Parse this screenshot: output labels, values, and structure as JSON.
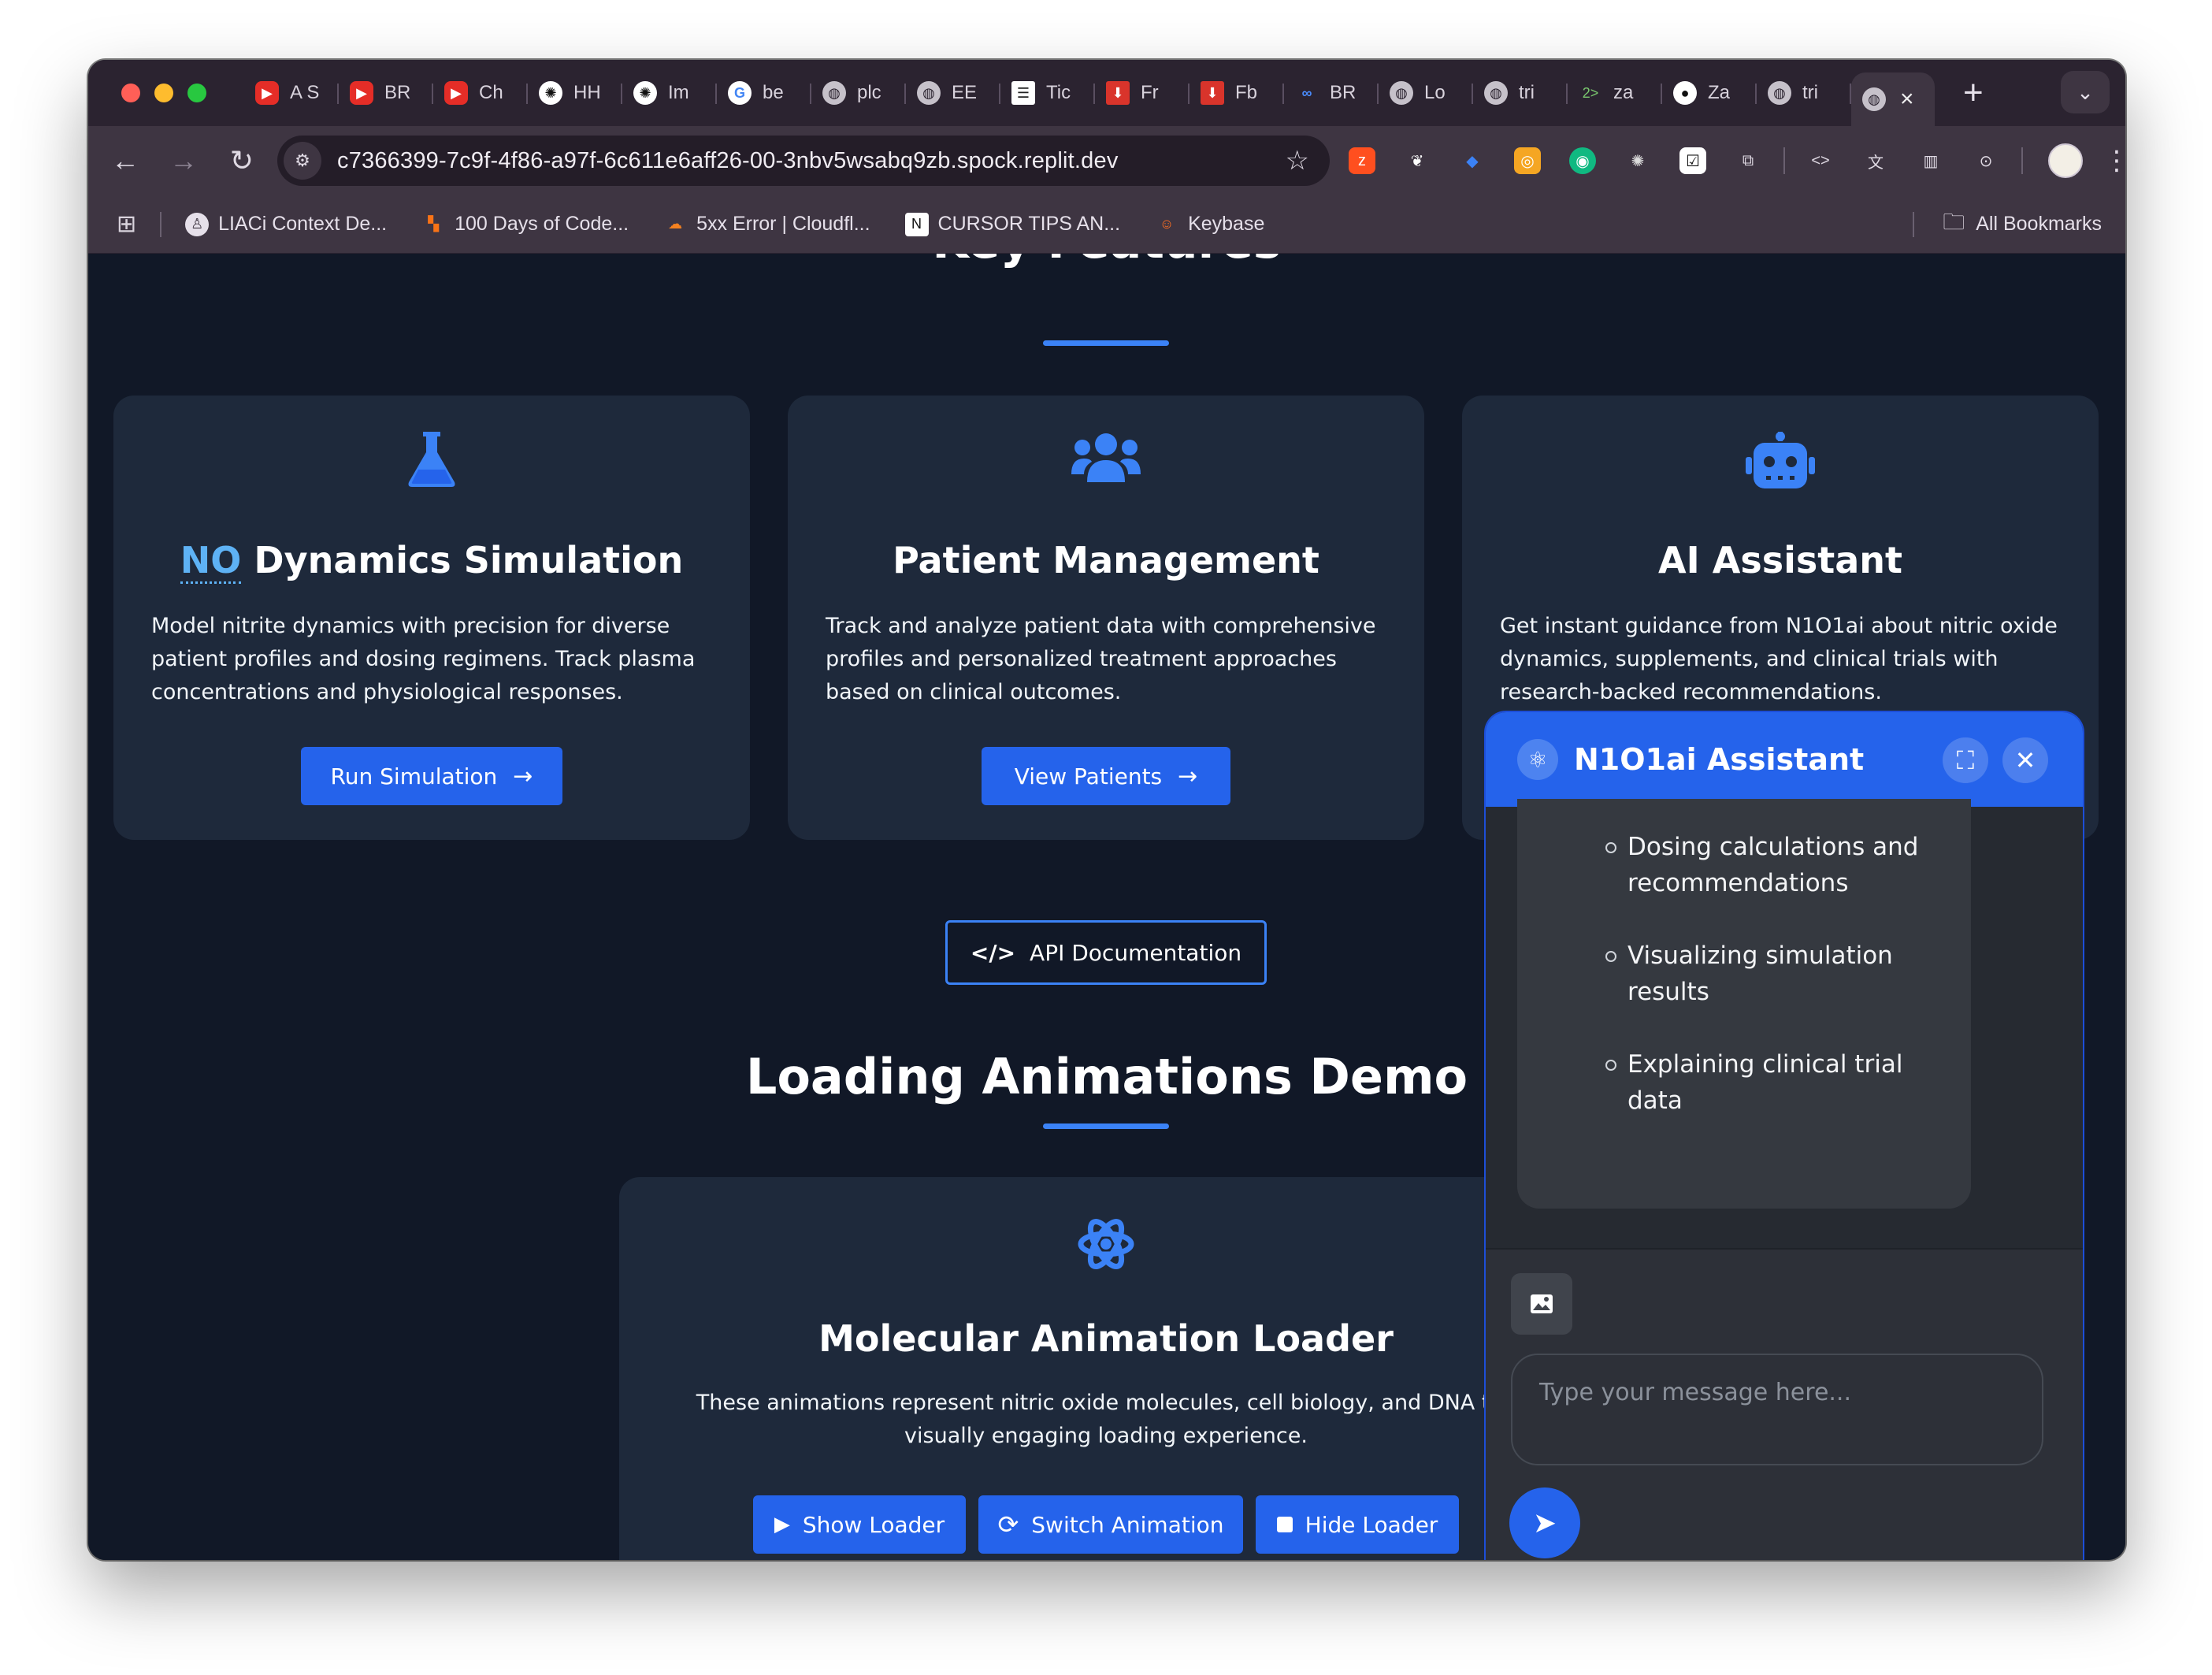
{
  "browser": {
    "tabs": [
      {
        "label": "A S",
        "icon": "youtube-icon"
      },
      {
        "label": "BR",
        "icon": "youtube-icon"
      },
      {
        "label": "Ch",
        "icon": "youtube-icon"
      },
      {
        "label": "HH",
        "icon": "openai-icon"
      },
      {
        "label": "Im",
        "icon": "openai-icon"
      },
      {
        "label": "be",
        "icon": "google-icon"
      },
      {
        "label": "plc",
        "icon": "globe-icon"
      },
      {
        "label": "EE",
        "icon": "globe-icon"
      },
      {
        "label": "Tic",
        "icon": "document-icon"
      },
      {
        "label": "Fr",
        "icon": "download-icon"
      },
      {
        "label": "Fb",
        "icon": "download-icon"
      },
      {
        "label": "BR",
        "icon": "link-icon"
      },
      {
        "label": "Lo",
        "icon": "globe-icon"
      },
      {
        "label": "tri",
        "icon": "globe-icon"
      },
      {
        "label": "za",
        "icon": "code-icon"
      },
      {
        "label": "Za",
        "icon": "github-icon"
      },
      {
        "label": "tri",
        "icon": "globe-icon"
      }
    ],
    "active_tab_close": "×",
    "new_tab": "+",
    "url": "c7366399-7c9f-4f86-a97f-6c611e6aff26-00-3nbv5wsabq9zb.spock.replit.dev",
    "bookmarks": [
      {
        "label": "LIACi Context De...",
        "icon": "liaci-icon"
      },
      {
        "label": "100 Days of Code...",
        "icon": "hundred-days-icon"
      },
      {
        "label": "5xx Error | Cloudfl...",
        "icon": "cloudflare-icon"
      },
      {
        "label": "CURSOR TIPS AN...",
        "icon": "notion-icon"
      },
      {
        "label": "Keybase",
        "icon": "keybase-icon"
      }
    ],
    "all_bookmarks": "All Bookmarks"
  },
  "page": {
    "clipped_heading": "Key Features",
    "features": [
      {
        "icon": "flask-icon",
        "title_abbr": "NO",
        "title_rest": " Dynamics Simulation",
        "description": "Model nitrite dynamics with precision for diverse patient profiles and dosing regimens. Track plasma concentrations and physiological responses.",
        "button": "Run Simulation"
      },
      {
        "icon": "users-icon",
        "title": "Patient Management",
        "description": "Track and analyze patient data with comprehensive profiles and personalized treatment approaches based on clinical outcomes.",
        "button": "View Patients"
      },
      {
        "icon": "robot-icon",
        "title": "AI Assistant",
        "description": "Get instant guidance from N1O1ai about nitric oxide dynamics, supplements, and clinical trials with research-backed recommendations."
      }
    ],
    "api_button": "API Documentation",
    "loading_title": "Loading Animations Demo",
    "loader_card": {
      "icon": "atom-icon",
      "title": "Molecular Animation Loader",
      "description_line1": "These animations represent nitric oxide molecules, cell biology, and DNA to provi",
      "description_line2": "visually engaging loading experience.",
      "buttons": {
        "show": "Show Loader",
        "switch": "Switch Animation",
        "hide": "Hide Loader"
      }
    }
  },
  "chat": {
    "title": "N1O1ai Assistant",
    "list_items": [
      "Dosing calculations and recommendations",
      "Visualizing simulation results",
      "Explaining clinical trial data"
    ],
    "input_placeholder": "Type your message here..."
  },
  "colors": {
    "page_bg": "#111827",
    "card_bg": "#1e293b",
    "accent": "#2563eb",
    "accent_light": "#3b82f6"
  }
}
